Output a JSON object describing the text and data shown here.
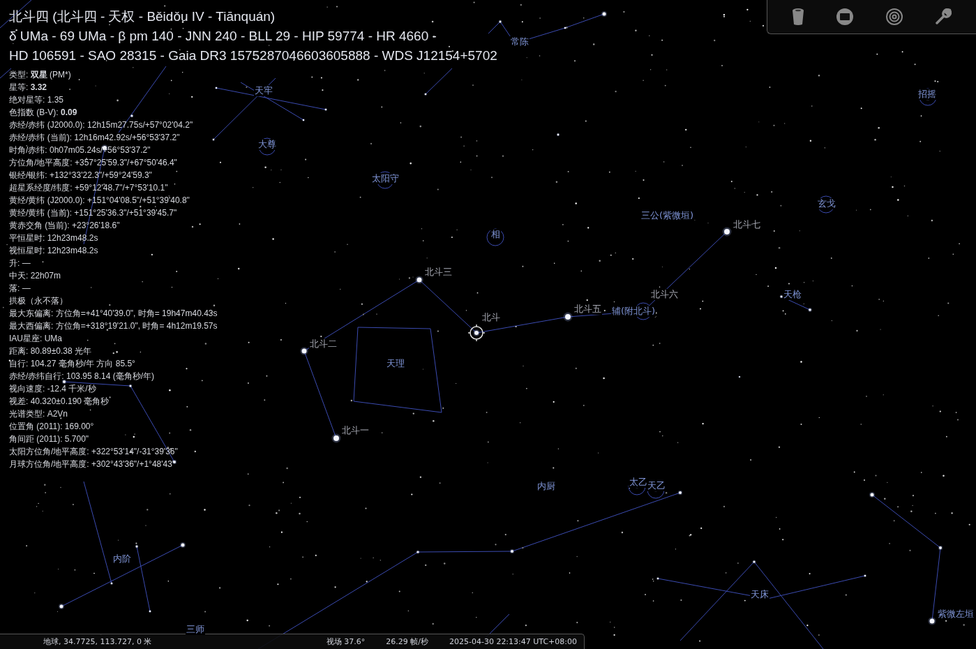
{
  "object_title": [
    "北斗四 (北斗四 - 天权 - Běidǒu IV - Tiānquán)",
    "δ UMa - 69 UMa - β pm 140 - JNN 240 - BLL 29 - HIP 59774 - HR 4660 -",
    "HD 106591 - SAO 28315 - Gaia DR3 1575287046603605888 - WDS J12154+5702"
  ],
  "info_lines": [
    "类型: **双星** (PM*)",
    "星等: **3.32**",
    "绝对星等: 1.35",
    "色指数 (B-V): **0.09**",
    "赤经/赤纬 (J2000.0): 12h15m27.75s/+57°02'04.2\"",
    "赤经/赤纬 (当前): 12h16m42.92s/+56°53'37.2\"",
    "时角/赤纬: 0h07m05.24s/+56°53'37.2\"",
    "方位角/地平高度: +357°25'59.3\"/+67°50'46.4\"",
    "银经/银纬: +132°33'22.3\"/+59°24'59.3\"",
    "超星系经度/纬度: +59°12'48.7\"/+7°53'10.1\"",
    "黄经/黄纬 (J2000.0): +151°04'08.5\"/+51°39'40.8\"",
    "黄经/黄纬 (当前): +151°25'36.3\"/+51°39'45.7\"",
    "黄赤交角 (当前): +23°26'18.6\"",
    "平恒星时: 12h23m48.2s",
    "视恒星时: 12h23m48.2s",
    "升: —",
    "中天: 22h07m",
    "落: —",
    "拱极（永不落）",
    "最大东偏离: 方位角=+41°40'39.0\", 时角= 19h47m40.43s",
    "最大西偏离: 方位角=+318°19'21.0\", 时角= 4h12m19.57s",
    "IAU星座: UMa",
    "距离: 80.89±0.38 光年",
    "自行: 104.27 毫角秒/年 方向 85.5°",
    "赤经/赤纬自行: 103.95 8.14 (毫角秒/年)",
    "视向速度: -12.4 千米/秒",
    "视差: 40.320±0.190 毫角秒",
    "光谱类型: A2Vn",
    "位置角 (2011): 169.00°",
    "角间距 (2011): 5.700\"",
    "太阳方位角/地平高度: +322°53'14\"/-31°39'36\"",
    "月球方位角/地平高度: +302°43'36\"/+1°48'43\""
  ],
  "sky_labels": [
    {
      "text": "常陈",
      "kind": "asterism"
    },
    {
      "text": "天牢",
      "kind": "asterism"
    },
    {
      "text": "大尊",
      "kind": "asterism"
    },
    {
      "text": "太阳守",
      "kind": "asterism"
    },
    {
      "text": "招摇",
      "kind": "asterism"
    },
    {
      "text": "三公(紫微垣)",
      "kind": "asterism"
    },
    {
      "text": "北斗七",
      "kind": "star"
    },
    {
      "text": "玄戈",
      "kind": "asterism"
    },
    {
      "text": "相",
      "kind": "asterism"
    },
    {
      "text": "天枪",
      "kind": "asterism"
    },
    {
      "text": "北斗三",
      "kind": "star"
    },
    {
      "text": "北斗",
      "kind": "star"
    },
    {
      "text": "北斗五",
      "kind": "star"
    },
    {
      "text": "辅(附北斗)",
      "kind": "asterism"
    },
    {
      "text": "北斗六",
      "kind": "star"
    },
    {
      "text": "北斗二",
      "kind": "star"
    },
    {
      "text": "天理",
      "kind": "asterism"
    },
    {
      "text": "北斗一",
      "kind": "star"
    },
    {
      "text": "内厨",
      "kind": "asterism"
    },
    {
      "text": "太乙",
      "kind": "asterism"
    },
    {
      "text": "天乙",
      "kind": "asterism"
    },
    {
      "text": "内阶",
      "kind": "asterism"
    },
    {
      "text": "天床",
      "kind": "asterism"
    },
    {
      "text": "紫微左垣",
      "kind": "asterism"
    },
    {
      "text": "三师",
      "kind": "asterism"
    }
  ],
  "status_bar": {
    "location": "地球, 34.7725, 113.727, 0 米",
    "fov": "视场 37.6°",
    "fps": "26.29 帧/秒",
    "datetime": "2025-04-30 22:13:47 UTC+08:00"
  }
}
